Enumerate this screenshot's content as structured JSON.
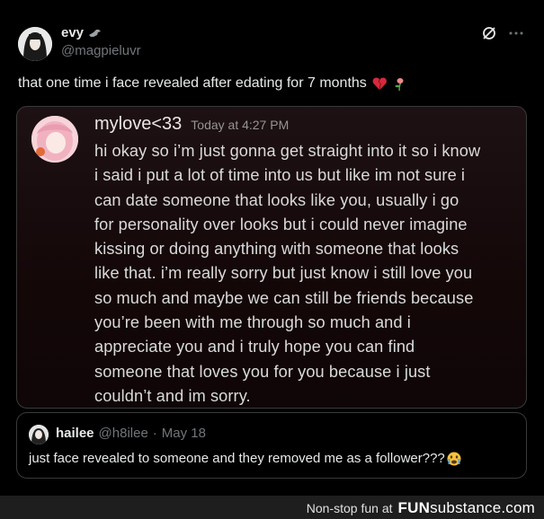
{
  "tweet": {
    "display_name": "evy",
    "handle": "@magpieluvr",
    "text": "that one time i face revealed after edating for 7 months",
    "emojis": [
      "broken-heart-emoji",
      "wilted-flower-emoji"
    ]
  },
  "message": {
    "username": "mylove<33",
    "timestamp": "Today at 4:27 PM",
    "lines": [
      "hi okay so i’m just gonna get straight into it so i know",
      "i said i put a lot of time into us but like im not sure i",
      "can date someone that looks like you, usually i go",
      "for personality over looks but i could never imagine",
      "kissing or doing anything with someone that looks",
      "like that. i’m really sorry but just know i still love you",
      "so much and maybe we can still be friends because",
      "you’re been with me through so much and i",
      "appreciate you and i truly hope you can find",
      "someone that loves you for you because i just",
      "couldn’t and im sorry."
    ]
  },
  "quote": {
    "name": "hailee",
    "handle": "@h8ilee",
    "separator": "·",
    "date": "May 18",
    "text": "just face revealed to someone and they removed me as a follower???",
    "emoji": "crying-emoji"
  },
  "footer": {
    "tagline": "Non-stop fun at",
    "brand_fun": "FUN",
    "brand_sub": "substance",
    "brand_tld": ".com"
  }
}
